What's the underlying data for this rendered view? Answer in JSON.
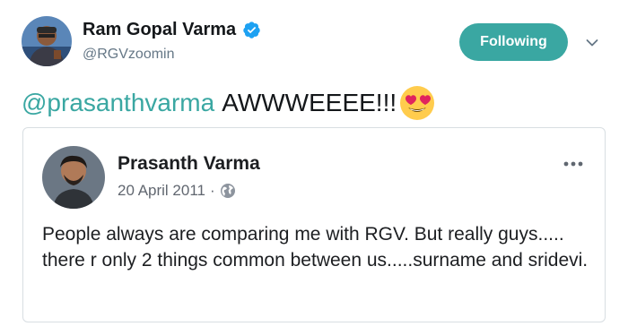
{
  "author": {
    "name": "Ram Gopal Varma",
    "handle": "@RGVzoomin",
    "verified_icon": "verified-badge-icon"
  },
  "follow_button": {
    "label": "Following"
  },
  "menu_icon": "chevron-down-icon",
  "tweet": {
    "mention": "@prasanthvarma",
    "text": "AWWWEEEE!!!",
    "emoji": "heart-eyes-emoji-icon"
  },
  "quoted_post": {
    "author_name": "Prasanth Varma",
    "date": "20 April 2011",
    "separator": "·",
    "privacy_icon": "globe-icon",
    "more_icon": "more-options-icon",
    "body": "People always are comparing me with RGV. But really guys..... there r only 2 things common between us.....surname and sridevi."
  },
  "colors": {
    "accent": "#3aa7a2",
    "verified": "#1da1f2",
    "text": "#14171a",
    "muted": "#657786",
    "card_border": "#d8dee2"
  }
}
